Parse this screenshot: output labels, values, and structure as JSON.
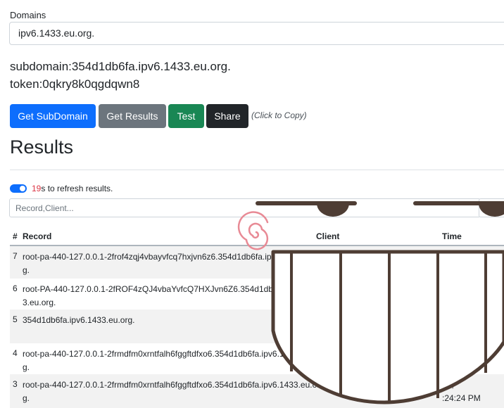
{
  "domains": {
    "label": "Domains",
    "selected": "ipv6.1433.eu.org."
  },
  "info": {
    "subdomain": "subdomain:354d1db6fa.ipv6.1433.eu.org.",
    "token": "token:0qkry8k0qgdqwn8"
  },
  "buttons": {
    "get_subdomain": "Get SubDomain",
    "get_results": "Get Results",
    "test": "Test",
    "share": "Share",
    "copy_hint": "(Click to Copy)"
  },
  "results": {
    "title": "Results",
    "refresh_count": "19",
    "refresh_text": "s to refresh results.",
    "filter_placeholder": "Record,Client...",
    "columns": {
      "num": "#",
      "record": "Record",
      "client": "Client",
      "time": "Time"
    },
    "rows": [
      {
        "num": "7",
        "record": "root-pa-440-127.0.0.1-2frof4zqj4vbayvfcq7hxjvn6z6.354d1db6fa.ipv6.1433.eu.org.",
        "time": ""
      },
      {
        "num": "6",
        "record": "root-PA-440-127.0.0.1-2fROF4zQJ4vbaYvfcQ7HXJvn6Z6.354d1db6fa.ipv6.1433.eu.org.",
        "time": ""
      },
      {
        "num": "5",
        "record": "354d1db6fa.ipv6.1433.eu.org.",
        "time": ""
      },
      {
        "num": "4",
        "record": "root-pa-440-127.0.0.1-2frmdfm0xrntfalh6fggftdfxo6.354d1db6fa.ipv6.1433.eu.org.",
        "time": ""
      },
      {
        "num": "3",
        "record": "root-pa-440-127.0.0.1-2frmdfm0xrntfalh6fggftdfxo6.354d1db6fa.ipv6.1433.eu.org.",
        "time": "24,\n:24:24 PM"
      }
    ]
  },
  "colors": {
    "primary": "#0d6efd",
    "secondary": "#6c757d",
    "success": "#198754",
    "dark": "#212529",
    "countdown": "#dc3545",
    "doodle": "#4e3d34",
    "spiral": "#e88a95"
  }
}
